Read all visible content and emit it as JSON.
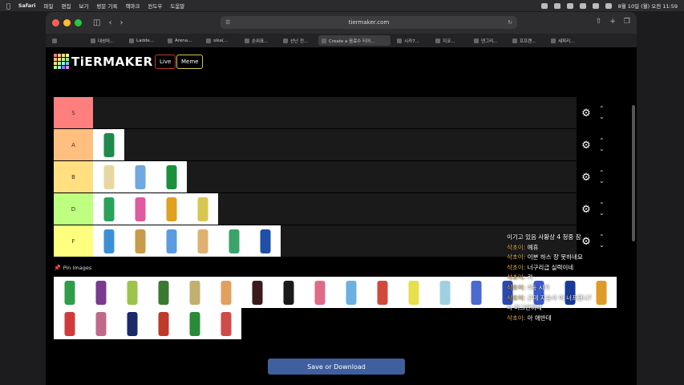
{
  "menubar": {
    "app": "Safari",
    "items": [
      "파일",
      "편집",
      "보기",
      "방문 기록",
      "책마크",
      "윈도우",
      "도움말"
    ],
    "clock": "8월 10일 (월) 오전 11:59"
  },
  "browser": {
    "url": "tiermaker.com",
    "tabs": [
      {
        "label": ""
      },
      {
        "label": "대성마..."
      },
      {
        "label": "Ladde..."
      },
      {
        "label": "Arena..."
      },
      {
        "label": "sika(..."
      },
      {
        "label": "손위표..."
      },
      {
        "label": "선난 전..."
      },
      {
        "label": "Create a 음료수 티어...",
        "active": true
      },
      {
        "label": "시카7..."
      },
      {
        "label": "지코..."
      },
      {
        "label": "덴그리..."
      },
      {
        "label": "프프랜..."
      },
      {
        "label": "세피리..."
      }
    ]
  },
  "site": {
    "logo": "TiERMAKER",
    "nav_live": "Live",
    "nav_meme": "Meme",
    "pin_label": "Pin Images",
    "save_button": "Save or Download"
  },
  "tiers": [
    {
      "label": "S",
      "color": "#ff7f7f",
      "items": []
    },
    {
      "label": "A",
      "color": "#ffbf7f",
      "items": [
        {
          "color": "#1f8a4c"
        }
      ]
    },
    {
      "label": "B",
      "color": "#ffdf7f",
      "items": [
        {
          "color": "#e8d7a1"
        },
        {
          "color": "#6fa9e0"
        },
        {
          "color": "#1c8f3d"
        }
      ]
    },
    {
      "label": "D",
      "color": "#bfff7f",
      "items": [
        {
          "color": "#2aa35a"
        },
        {
          "color": "#e05aa0"
        },
        {
          "color": "#e0a020"
        },
        {
          "color": "#d9c650"
        }
      ]
    },
    {
      "label": "F",
      "color": "#ffff7f",
      "items": [
        {
          "color": "#3c8fd6"
        },
        {
          "color": "#c99a4c"
        },
        {
          "color": "#5b9be0"
        },
        {
          "color": "#e0b070"
        },
        {
          "color": "#3aa36a"
        },
        {
          "color": "#1f4fa8"
        }
      ]
    }
  ],
  "bank": {
    "row1": [
      {
        "color": "#2e9e4a"
      },
      {
        "color": "#7a3a8f"
      },
      {
        "color": "#9ec34a"
      },
      {
        "color": "#3a7a30"
      },
      {
        "color": "#c2b070"
      },
      {
        "color": "#e0a060"
      },
      {
        "color": "#3a1a1a"
      },
      {
        "color": "#1a1a1a"
      },
      {
        "color": "#e06a8a"
      },
      {
        "color": "#6ab0e0"
      },
      {
        "color": "#d04a3a"
      },
      {
        "color": "#e8e04a"
      },
      {
        "color": "#a0d0e0"
      },
      {
        "color": "#4a6ad0"
      },
      {
        "color": "#2a4ab0"
      },
      {
        "color": "#3a5ad0"
      },
      {
        "color": "#1a3a9a"
      },
      {
        "color": "#e09a2a"
      }
    ],
    "row2": [
      {
        "color": "#d03a3a"
      },
      {
        "color": "#c06a8a"
      },
      {
        "color": "#1a2a6a"
      },
      {
        "color": "#c03a2a"
      },
      {
        "color": "#2a8a3a"
      },
      {
        "color": "#d04a4a"
      }
    ]
  },
  "chat": [
    {
      "user": "",
      "msg": "이기고 있음 사황상 4 청중 잠"
    },
    {
      "user": "삭초이:",
      "msg": "예휴"
    },
    {
      "user": "삭초이:",
      "msg": "이분 하스 장 못하네요"
    },
    {
      "user": "삭초이:",
      "msg": "너구리급 실력이네"
    },
    {
      "user": "삭초이:",
      "msg": "카"
    },
    {
      "user": "삭초이:",
      "msg": "4등 시카"
    },
    {
      "user": "삭초이:",
      "msg": "근데 지숭사 머 너프됐나? 다 머그만하네"
    },
    {
      "user": "삭초이:",
      "msg": "아 애반데"
    }
  ]
}
